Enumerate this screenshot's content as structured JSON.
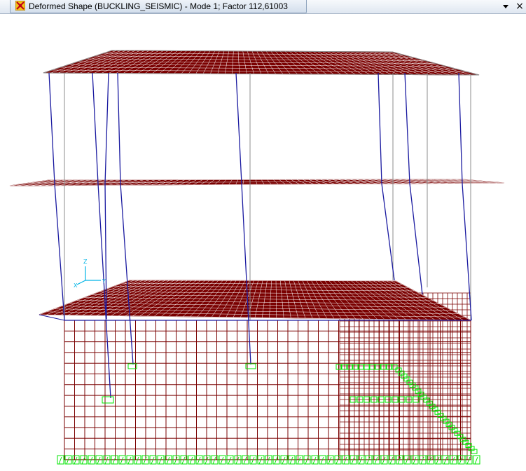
{
  "window": {
    "title": "Deformed Shape (BUCKLING_SEISMIC) - Mode 1; Factor 112,61003",
    "close_label": "×",
    "dropdown_label": "▼"
  },
  "icons": {
    "app": "structure-app-icon",
    "dropdown": "chevron-down-icon",
    "close": "close-icon"
  },
  "axes_triad": {
    "x_label": "X",
    "y_label": "Y",
    "z_label": "Z"
  },
  "colors": {
    "deformed_mesh": "#7a0000",
    "deformed_columns": "#1a1aa0",
    "undeformed": "#8c8c8c",
    "supports": "#00e600",
    "triad": "#00b4e6"
  }
}
